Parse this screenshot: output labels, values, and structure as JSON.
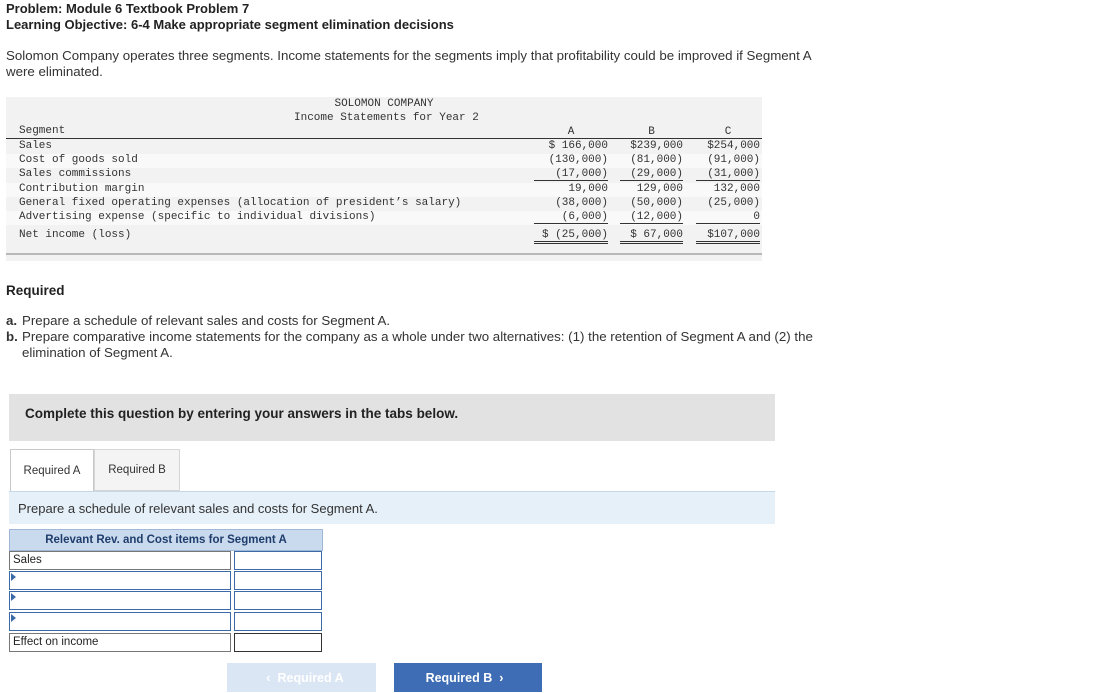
{
  "header": {
    "problem": "Problem: Module 6 Textbook Problem 7",
    "objective": "Learning Objective: 6-4 Make appropriate segment elimination decisions"
  },
  "intro": "Solomon Company operates three segments. Income statements for the segments imply that profitability could be improved if Segment A were eliminated.",
  "statement": {
    "company": "SOLOMON COMPANY",
    "title": "Income Statements for Year 2",
    "segment_label": "Segment",
    "columns": [
      "A",
      "B",
      "C"
    ],
    "rows": [
      {
        "label": "Sales",
        "values": [
          "$ 166,000",
          "$239,000",
          "$254,000"
        ]
      },
      {
        "label": "Cost of goods sold",
        "values": [
          "(130,000)",
          "(81,000)",
          "(91,000)"
        ]
      },
      {
        "label": "Sales commissions",
        "values": [
          "(17,000)",
          "(29,000)",
          "(31,000)"
        ]
      },
      {
        "label": "Contribution margin",
        "values": [
          "19,000",
          "129,000",
          "132,000"
        ]
      },
      {
        "label": "General fixed operating expenses (allocation of president’s salary)",
        "values": [
          "(38,000)",
          "(50,000)",
          "(25,000)"
        ]
      },
      {
        "label": "Advertising expense (specific to individual divisions)",
        "values": [
          "(6,000)",
          "(12,000)",
          "0"
        ]
      },
      {
        "label": "Net income (loss)",
        "values": [
          "$ (25,000)",
          "$ 67,000",
          "$107,000"
        ]
      }
    ]
  },
  "required": {
    "title": "Required",
    "a_marker": "a.",
    "a_text": "Prepare a schedule of relevant sales and costs for Segment A.",
    "b_marker": "b.",
    "b_text": "Prepare comparative income statements for the company as a whole under two alternatives: (1) the retention of Segment A and (2) the elimination of Segment A."
  },
  "banner": "Complete this question by entering your answers in the tabs below.",
  "tabs": [
    {
      "label": "Required A",
      "active": true
    },
    {
      "label": "Required B",
      "active": false
    }
  ],
  "instruction": "Prepare a schedule of relevant sales and costs for Segment A.",
  "schedule": {
    "header": "Relevant Rev. and Cost items for Segment A",
    "rows": [
      {
        "label": "Sales",
        "value": ""
      },
      {
        "label": "",
        "value": ""
      },
      {
        "label": "",
        "value": ""
      },
      {
        "label": "",
        "value": ""
      },
      {
        "label": "Effect on income",
        "value": ""
      }
    ]
  },
  "nav": {
    "prev_label": "Required A",
    "next_label": "Required B",
    "prev_icon": "chevron-left-icon",
    "next_icon": "chevron-right-icon"
  },
  "colors": {
    "banner_bg": "#e2e2e2",
    "instruction_bg": "#e6f0f9",
    "schedule_header_bg": "#c9daef",
    "next_button": "#3f6db5",
    "prev_button_disabled": "#dbe6f4"
  }
}
